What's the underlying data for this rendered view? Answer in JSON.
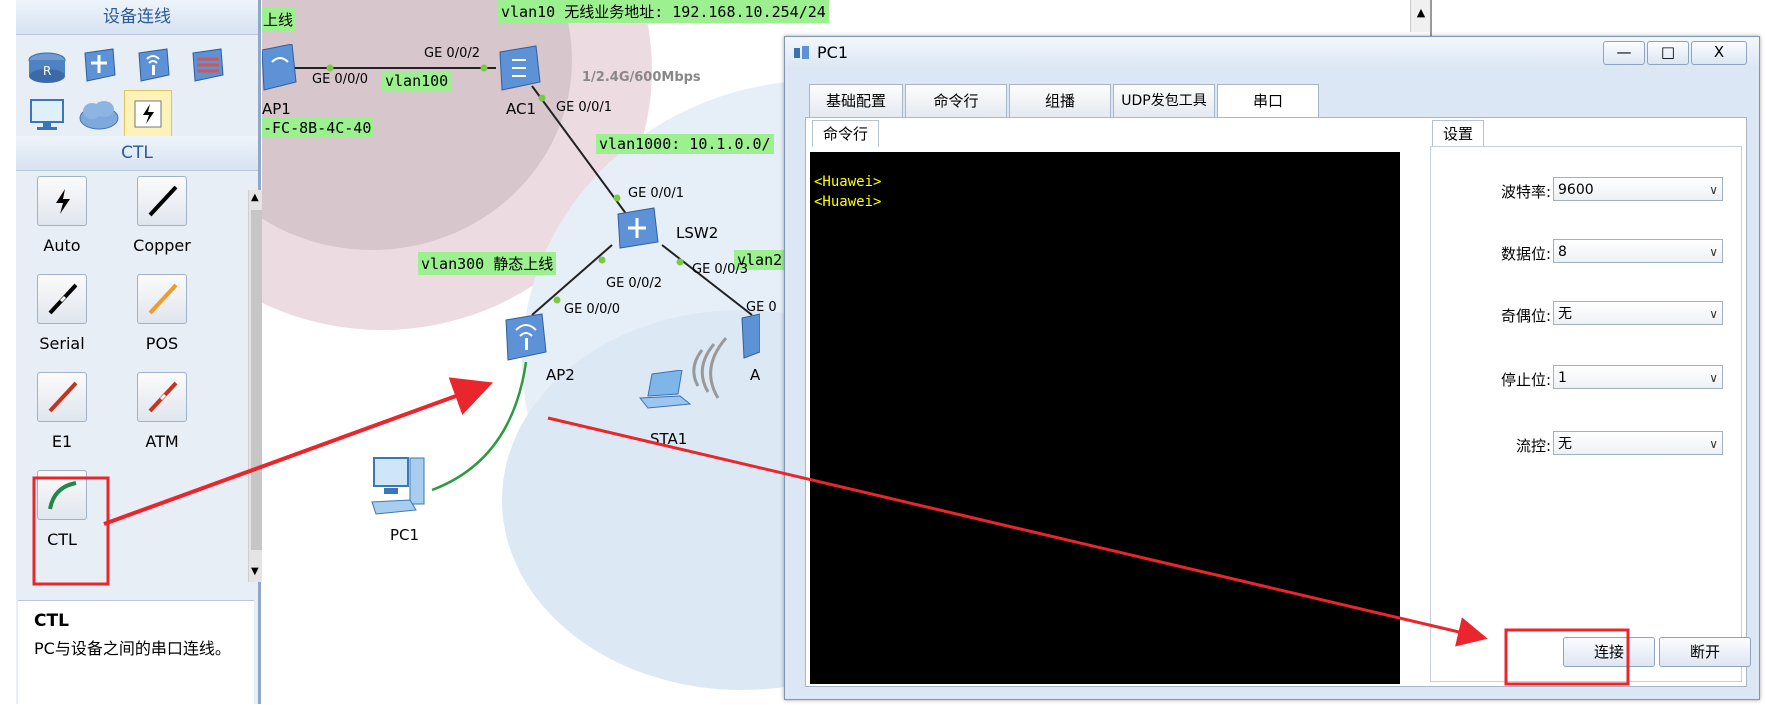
{
  "left_panel": {
    "header": "设备连线",
    "device_icons": [
      "router-icon",
      "switch-icon",
      "wireless-icon",
      "firewall-icon",
      "pc-icon",
      "cloud-icon",
      "auto-cable-icon"
    ],
    "section_header": "CTL",
    "cables": [
      {
        "label": "Auto",
        "icon": "auto-cable-icon"
      },
      {
        "label": "Copper",
        "icon": "copper-cable-icon"
      },
      {
        "label": "Serial",
        "icon": "serial-cable-icon"
      },
      {
        "label": "POS",
        "icon": "pos-cable-icon"
      },
      {
        "label": "E1",
        "icon": "e1-cable-icon"
      },
      {
        "label": "ATM",
        "icon": "atm-cable-icon"
      },
      {
        "label": "CTL",
        "icon": "ctl-cable-icon"
      }
    ],
    "description_title": "CTL",
    "description_text": "PC与设备之间的串口连线。"
  },
  "topology": {
    "labels": {
      "up_line": "上线",
      "vlan10": "vlan10 无线业务地址: 192.168.10.254/24",
      "mac": "-FC-8B-4C-40",
      "vlan100": "vlan100",
      "vlan1000": "vlan1000: 10.1.0.0/",
      "vlan300": "vlan300 静态上线",
      "vlan2_partial": "vlan2"
    },
    "ports": {
      "ge002_ac": "GE 0/0/2",
      "ge000_ap1": "GE 0/0/0",
      "ge001_ac": "GE 0/0/1",
      "ge001_lsw": "GE 0/0/1",
      "ge002_lsw": "GE 0/0/2",
      "ge003_lsw": "GE 0/0/3",
      "ge000_ap2": "GE 0/0/0",
      "ge0_partial": "GE 0",
      "rate": "1/2.4G/600Mbps"
    },
    "devices": {
      "ap1": "AP1",
      "ac1": "AC1",
      "lsw2": "LSW2",
      "ap2": "AP2",
      "sta1": "STA1",
      "pc1": "PC1",
      "ap_partial": "A"
    }
  },
  "window": {
    "title": "PC1",
    "controls": {
      "minimize": "—",
      "maximize": "□",
      "close": "X"
    },
    "tabs": [
      "基础配置",
      "命令行",
      "组播",
      "UDP发包工具",
      "串口"
    ],
    "active_tab": "串口",
    "terminal_group": "命令行",
    "terminal_lines": [
      "<Huawei>",
      "<Huawei>"
    ],
    "settings_group": "设置",
    "settings": [
      {
        "label": "波特率:",
        "value": "9600"
      },
      {
        "label": "数据位:",
        "value": "8"
      },
      {
        "label": "奇偶位:",
        "value": "无"
      },
      {
        "label": "停止位:",
        "value": "1"
      },
      {
        "label": "流控:",
        "value": "无"
      }
    ],
    "buttons": {
      "connect": "连接",
      "disconnect": "断开"
    }
  },
  "colors": {
    "highlight_red": "#e8262b",
    "vlan_label_green": "#9df08f",
    "terminal_text": "#ffff00"
  }
}
